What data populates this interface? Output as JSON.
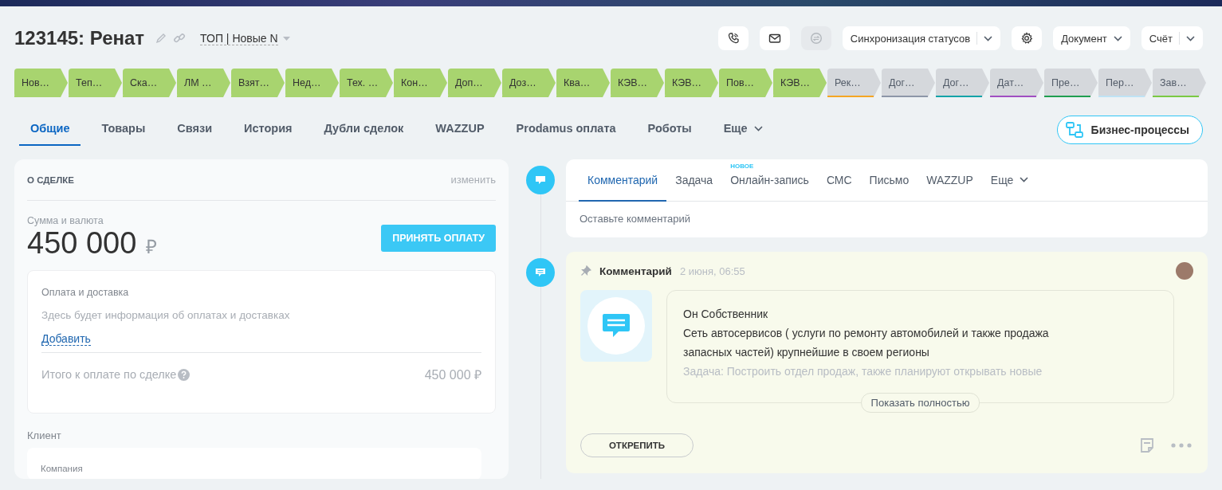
{
  "header": {
    "title": "123145: Ренат",
    "category": "ТОП | Новые N",
    "actions": [
      {
        "kind": "icon",
        "disabled": false
      },
      {
        "kind": "icon",
        "disabled": false
      },
      {
        "kind": "icon",
        "disabled": true
      },
      {
        "kind": "split",
        "label": "Синхронизация статусов"
      },
      {
        "kind": "icon",
        "disabled": false
      },
      {
        "kind": "dropdown",
        "label": "Документ"
      },
      {
        "kind": "split",
        "label": "Счёт"
      }
    ]
  },
  "stages": [
    {
      "label": "Нов…",
      "reached": true,
      "color": "#a8d46f"
    },
    {
      "label": "Теп…",
      "reached": true,
      "color": "#a8d46f"
    },
    {
      "label": "Ска…",
      "reached": true,
      "color": "#a8d46f"
    },
    {
      "label": "ЛМ …",
      "reached": true,
      "color": "#a8d46f"
    },
    {
      "label": "Взят…",
      "reached": true,
      "color": "#a8d46f"
    },
    {
      "label": "Нед…",
      "reached": true,
      "color": "#a8d46f"
    },
    {
      "label": "Тех. …",
      "reached": true,
      "color": "#a8d46f"
    },
    {
      "label": "Кон…",
      "reached": true,
      "color": "#a8d46f"
    },
    {
      "label": "Доп…",
      "reached": true,
      "color": "#a8d46f"
    },
    {
      "label": "Доз…",
      "reached": true,
      "color": "#a8d46f"
    },
    {
      "label": "Ква…",
      "reached": true,
      "color": "#a8d46f"
    },
    {
      "label": "КЭВ…",
      "reached": true,
      "color": "#a8d46f"
    },
    {
      "label": "КЭВ…",
      "reached": true,
      "color": "#a8d46f"
    },
    {
      "label": "Пов…",
      "reached": true,
      "color": "#a8d46f"
    },
    {
      "label": "КЭВ…",
      "reached": true,
      "color": "#a8d46f"
    },
    {
      "label": "Рек…",
      "reached": false,
      "color": "#f5a623"
    },
    {
      "label": "Дог…",
      "reached": false,
      "color": "#8d96a8"
    },
    {
      "label": "Дог…",
      "reached": false,
      "color": "#14a3a8"
    },
    {
      "label": "Дат…",
      "reached": false,
      "color": "#a14fc1"
    },
    {
      "label": "Пре…",
      "reached": false,
      "color": "#1f9e4f"
    },
    {
      "label": "Пер…",
      "reached": false,
      "color": "#bfe3f5"
    },
    {
      "label": "Зав…",
      "reached": false,
      "color": "#7ac943"
    }
  ],
  "tabs": [
    {
      "label": "Общие",
      "selected": true
    },
    {
      "label": "Товары",
      "selected": false
    },
    {
      "label": "Связи",
      "selected": false
    },
    {
      "label": "История",
      "selected": false
    },
    {
      "label": "Дубли сделок",
      "selected": false
    },
    {
      "label": "WAZZUP",
      "selected": false
    },
    {
      "label": "Prodamus оплата",
      "selected": false
    },
    {
      "label": "Роботы",
      "selected": false
    },
    {
      "label": "Еще",
      "selected": false,
      "dropdown": true
    }
  ],
  "business_process_button": "Бизнес-процессы",
  "deal_panel": {
    "title": "О СДЕЛКЕ",
    "edit_link": "изменить",
    "amount_label": "Сумма и валюта",
    "amount": "450 000",
    "currency": "₽",
    "pay_button": "ПРИНЯТЬ ОПЛАТУ",
    "payment": {
      "title": "Оплата и доставка",
      "empty_text": "Здесь будет информация об оплатах и доставках",
      "add_link": "Добавить",
      "total_label": "Итого к оплате по сделке",
      "total_value": "450 000 ₽"
    },
    "client_label": "Клиент",
    "company_label": "Компания"
  },
  "activity_editor": {
    "tabs": [
      {
        "label": "Комментарий",
        "selected": true
      },
      {
        "label": "Задача",
        "selected": false
      },
      {
        "label": "Онлайн-запись",
        "selected": false,
        "badge": "НОВОЕ"
      },
      {
        "label": "СМС",
        "selected": false
      },
      {
        "label": "Письмо",
        "selected": false
      },
      {
        "label": "WAZZUP",
        "selected": false
      },
      {
        "label": "Еще",
        "selected": false,
        "dropdown": true
      }
    ],
    "placeholder": "Оставьте комментарий"
  },
  "pinned_comment": {
    "title": "Комментарий",
    "time": "2 июня, 06:55",
    "lines": [
      {
        "text": "Он Собственник",
        "faded": false
      },
      {
        "text": "Сеть автосервисов ( услуги по ремонту автомобилей и также продажа",
        "faded": false
      },
      {
        "text": "запасных частей) крупнейшие в своем регионы",
        "faded": false
      },
      {
        "text": "Задача: Построить отдел продаж, также планируют открывать новые",
        "faded": true
      }
    ],
    "show_more": "Показать полностью",
    "unpin_button": "ОТКРЕПИТЬ"
  }
}
